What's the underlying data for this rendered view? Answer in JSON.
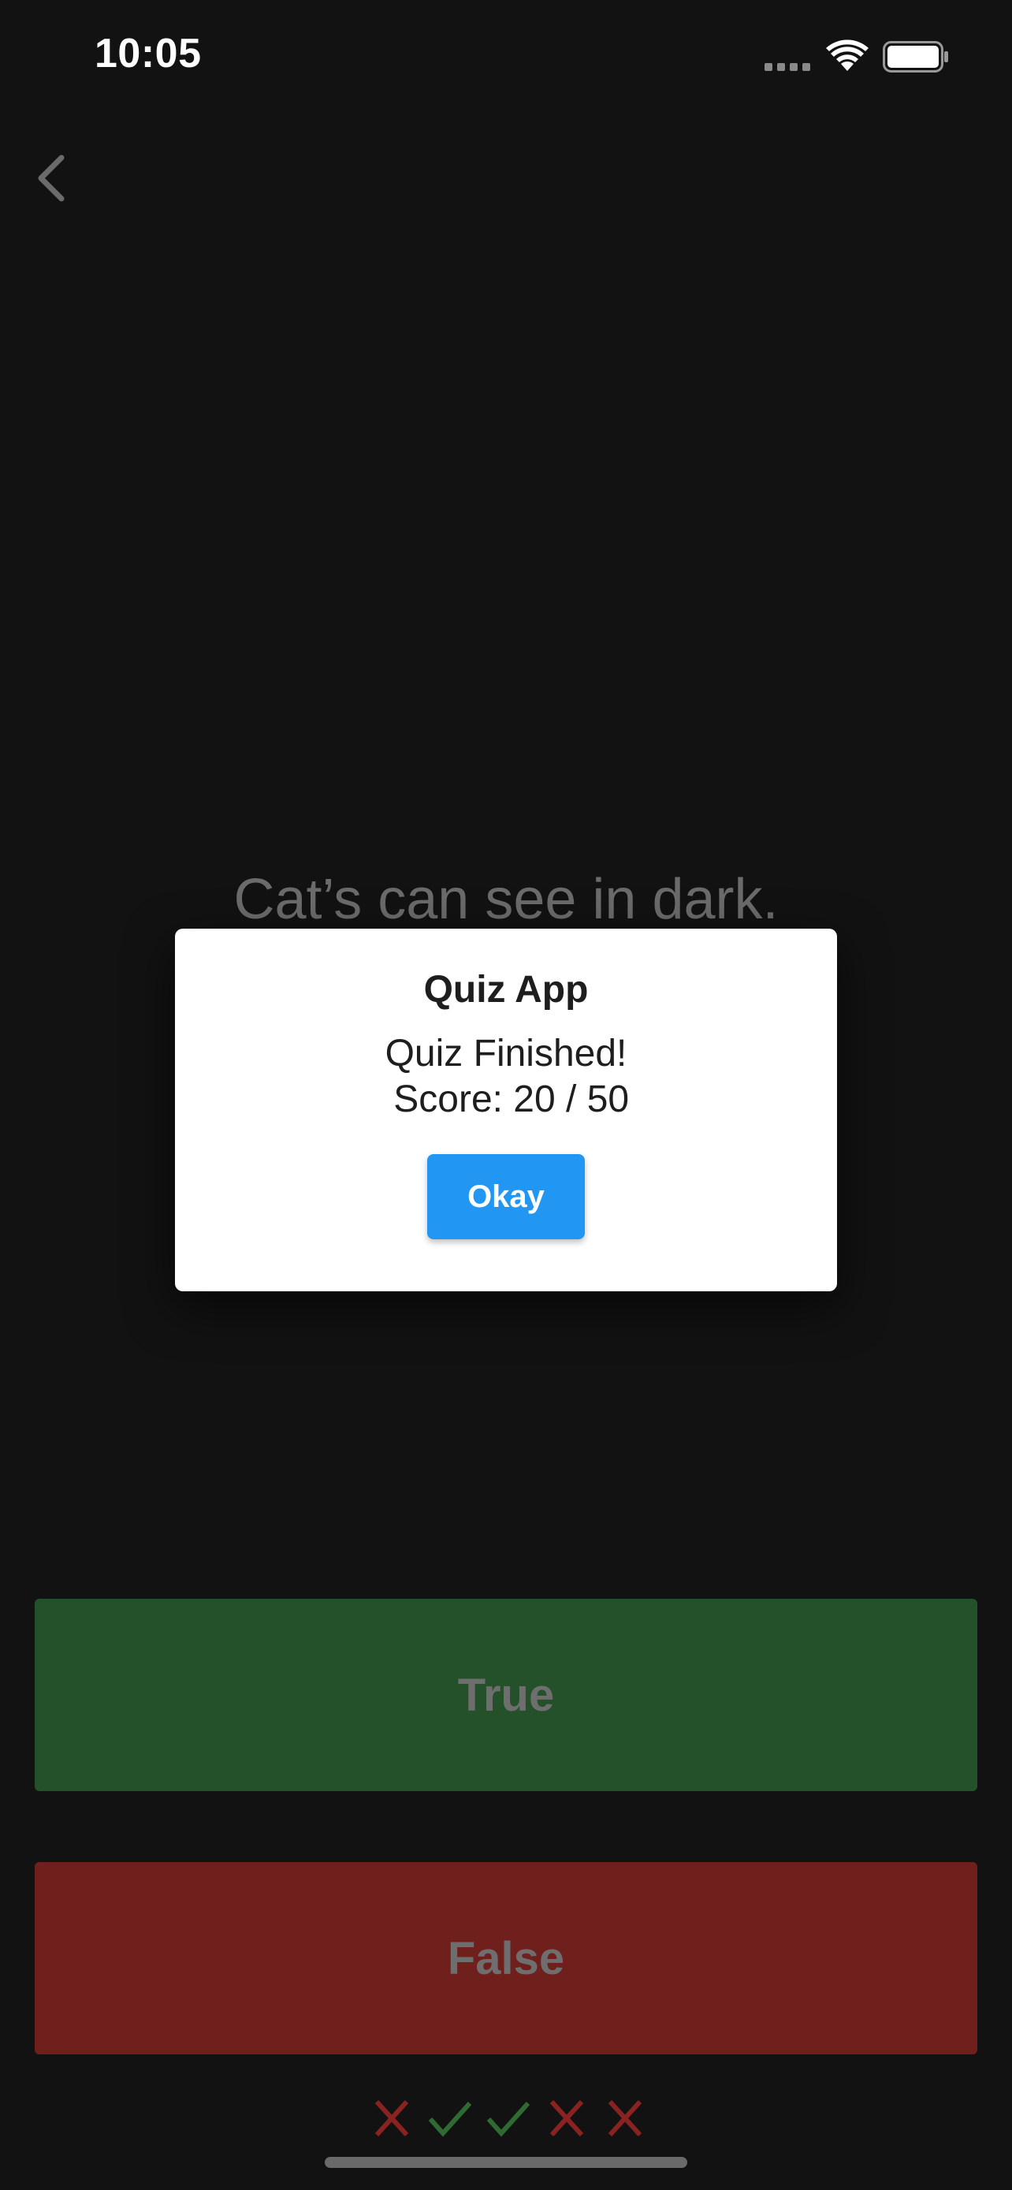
{
  "status_bar": {
    "time": "10:05"
  },
  "nav": {
    "back_icon": "chevron-left-icon"
  },
  "quiz": {
    "question": "Cat’s can see in dark.",
    "true_label": "True",
    "false_label": "False",
    "score_marks": [
      {
        "icon": "cross-icon",
        "color": "#8b2222"
      },
      {
        "icon": "check-icon",
        "color": "#2e6b33"
      },
      {
        "icon": "check-icon",
        "color": "#2e6b33"
      },
      {
        "icon": "cross-icon",
        "color": "#8b2222"
      },
      {
        "icon": "cross-icon",
        "color": "#8b2222"
      }
    ]
  },
  "dialog": {
    "title": "Quiz App",
    "message_line1": "Quiz Finished!",
    "message_line2": " Score: 20 / 50",
    "okay_label": "Okay",
    "okay_color": "#2196f3"
  },
  "colors": {
    "background": "#121212",
    "true_button": "#24502a",
    "false_button": "#6f1f1c"
  }
}
